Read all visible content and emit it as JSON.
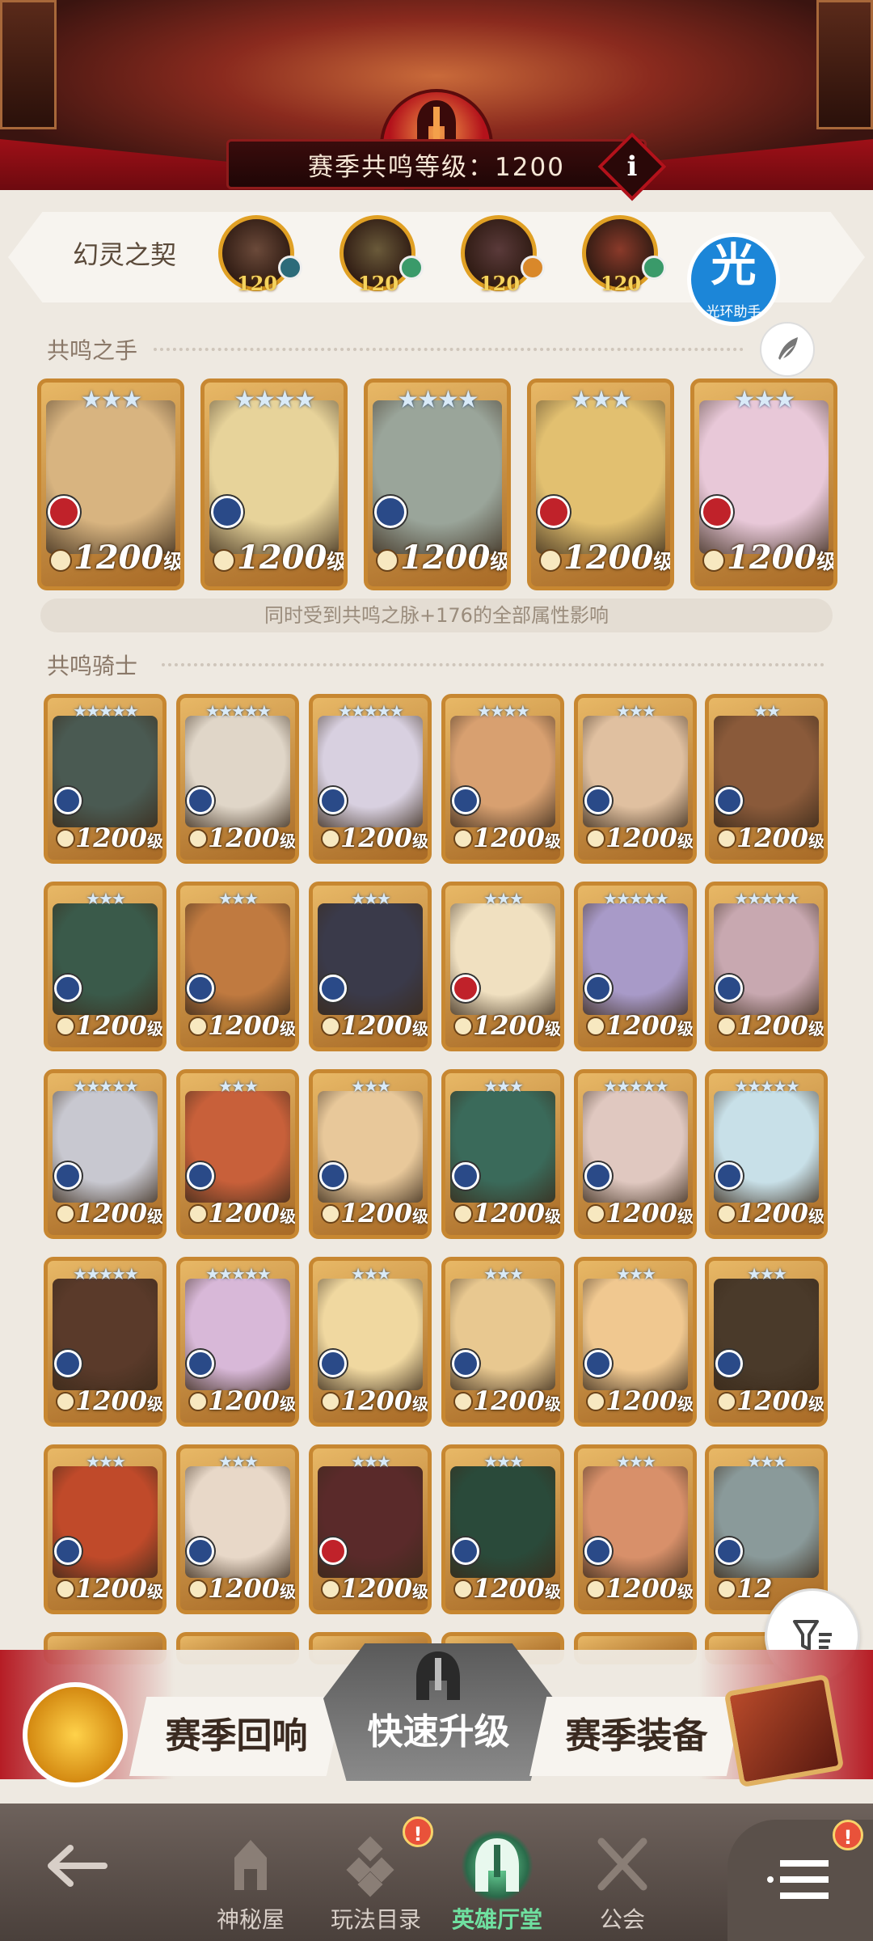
{
  "header": {
    "resonance_level_text": "赛季共鸣等级：1200",
    "info_label": "i"
  },
  "pact": {
    "label": "幻灵之契",
    "slots": [
      {
        "level": "120",
        "portrait": "#6b4a3a",
        "elem": "#2c6b7a"
      },
      {
        "level": "120",
        "portrait": "#6a5a3a",
        "elem": "#3a9a6a"
      },
      {
        "level": "120",
        "portrait": "#5a3a3a",
        "elem": "#d9882a"
      },
      {
        "level": "120",
        "portrait": "#8a3a2a",
        "elem": "#3a9a6a"
      }
    ],
    "assistant": {
      "glyph": "光",
      "label": "光环助手"
    }
  },
  "resonance_hands": {
    "title": "共鸣之手",
    "note": "同时受到共鸣之脉+176的全部属性影响",
    "heroes": [
      {
        "level": "1200",
        "unit": "级",
        "stars": "★★★",
        "bg": "#d8b480",
        "faction": "#c0222a"
      },
      {
        "level": "1200",
        "unit": "级",
        "stars": "★★★★",
        "bg": "#e7d39a",
        "faction": "#2a4a88"
      },
      {
        "level": "1200",
        "unit": "级",
        "stars": "★★★★",
        "bg": "#9aa59a",
        "faction": "#2a4a88"
      },
      {
        "level": "1200",
        "unit": "级",
        "stars": "★★★",
        "bg": "#e2c070",
        "faction": "#c0222a"
      },
      {
        "level": "1200",
        "unit": "级",
        "stars": "★★★",
        "bg": "#e8c8d8",
        "faction": "#c0222a"
      }
    ]
  },
  "resonance_knights": {
    "title": "共鸣骑士",
    "heroes": [
      {
        "level": "1200",
        "unit": "级",
        "stars": "★★★★★",
        "bg": "#4a5a52",
        "faction": "#2a4a88"
      },
      {
        "level": "1200",
        "unit": "级",
        "stars": "★★★★★",
        "bg": "#e0d6c8",
        "faction": "#2a4a88"
      },
      {
        "level": "1200",
        "unit": "级",
        "stars": "★★★★★",
        "bg": "#d8d0e0",
        "faction": "#2a4a88"
      },
      {
        "level": "1200",
        "unit": "级",
        "stars": "★★★★",
        "bg": "#d8a070",
        "faction": "#2a4a88"
      },
      {
        "level": "1200",
        "unit": "级",
        "stars": "★★★",
        "bg": "#e0c0a0",
        "faction": "#2a4a88"
      },
      {
        "level": "1200",
        "unit": "级",
        "stars": "★★",
        "bg": "#8a5a3a",
        "faction": "#2a4a88"
      },
      {
        "level": "1200",
        "unit": "级",
        "stars": "★★★",
        "bg": "#3a5a4a",
        "faction": "#2a4a88"
      },
      {
        "level": "1200",
        "unit": "级",
        "stars": "★★★",
        "bg": "#c07a40",
        "faction": "#2a4a88"
      },
      {
        "level": "1200",
        "unit": "级",
        "stars": "★★★",
        "bg": "#3a3a4a",
        "faction": "#2a4a88"
      },
      {
        "level": "1200",
        "unit": "级",
        "stars": "★★★",
        "bg": "#f0e0c0",
        "faction": "#c0222a"
      },
      {
        "level": "1200",
        "unit": "级",
        "stars": "★★★★★",
        "bg": "#a89ac8",
        "faction": "#2a4a88"
      },
      {
        "level": "1200",
        "unit": "级",
        "stars": "★★★★★",
        "bg": "#c8a8b0",
        "faction": "#2a4a88"
      },
      {
        "level": "1200",
        "unit": "级",
        "stars": "★★★★★",
        "bg": "#c8c8d0",
        "faction": "#2a4a88"
      },
      {
        "level": "1200",
        "unit": "级",
        "stars": "★★★",
        "bg": "#c8603a",
        "faction": "#2a4a88"
      },
      {
        "level": "1200",
        "unit": "级",
        "stars": "★★★",
        "bg": "#e8c89a",
        "faction": "#2a4a88"
      },
      {
        "level": "1200",
        "unit": "级",
        "stars": "★★★",
        "bg": "#3a6a5a",
        "faction": "#2a4a88"
      },
      {
        "level": "1200",
        "unit": "级",
        "stars": "★★★★★",
        "bg": "#e0c8c0",
        "faction": "#2a4a88"
      },
      {
        "level": "1200",
        "unit": "级",
        "stars": "★★★★★",
        "bg": "#c8e0e8",
        "faction": "#2a4a88"
      },
      {
        "level": "1200",
        "unit": "级",
        "stars": "★★★★★",
        "bg": "#5a3a2a",
        "faction": "#2a4a88"
      },
      {
        "level": "1200",
        "unit": "级",
        "stars": "★★★★★",
        "bg": "#d8b8d8",
        "faction": "#2a4a88"
      },
      {
        "level": "1200",
        "unit": "级",
        "stars": "★★★",
        "bg": "#f0d8a0",
        "faction": "#2a4a88"
      },
      {
        "level": "1200",
        "unit": "级",
        "stars": "★★★",
        "bg": "#e8c890",
        "faction": "#2a4a88"
      },
      {
        "level": "1200",
        "unit": "级",
        "stars": "★★★",
        "bg": "#f0c890",
        "faction": "#2a4a88"
      },
      {
        "level": "1200",
        "unit": "级",
        "stars": "★★★",
        "bg": "#4a3a2a",
        "faction": "#2a4a88"
      },
      {
        "level": "1200",
        "unit": "级",
        "stars": "★★★",
        "bg": "#c04a2a",
        "faction": "#2a4a88"
      },
      {
        "level": "1200",
        "unit": "级",
        "stars": "★★★",
        "bg": "#e8d8c8",
        "faction": "#2a4a88"
      },
      {
        "level": "1200",
        "unit": "级",
        "stars": "★★★",
        "bg": "#5a2a2a",
        "faction": "#c0222a"
      },
      {
        "level": "1200",
        "unit": "级",
        "stars": "★★★",
        "bg": "#2a4a3a",
        "faction": "#2a4a88"
      },
      {
        "level": "1200",
        "unit": "级",
        "stars": "★★★",
        "bg": "#d8906a",
        "faction": "#2a4a88"
      },
      {
        "level": "12",
        "unit": "",
        "stars": "★★★",
        "bg": "#8a9a9a",
        "faction": "#2a4a88"
      }
    ]
  },
  "actions": {
    "season_echo": "赛季回响",
    "quick_upgrade": "快速升级",
    "season_gear": "赛季装备"
  },
  "nav": {
    "items": [
      {
        "label": "神秘屋"
      },
      {
        "label": "玩法目录"
      },
      {
        "label": "英雄厅堂"
      },
      {
        "label": "公会"
      }
    ],
    "alert": "!"
  },
  "colors": {
    "accent_red": "#b3121b",
    "gold_frame": "#c78731",
    "active_nav": "#6fe0a0"
  }
}
